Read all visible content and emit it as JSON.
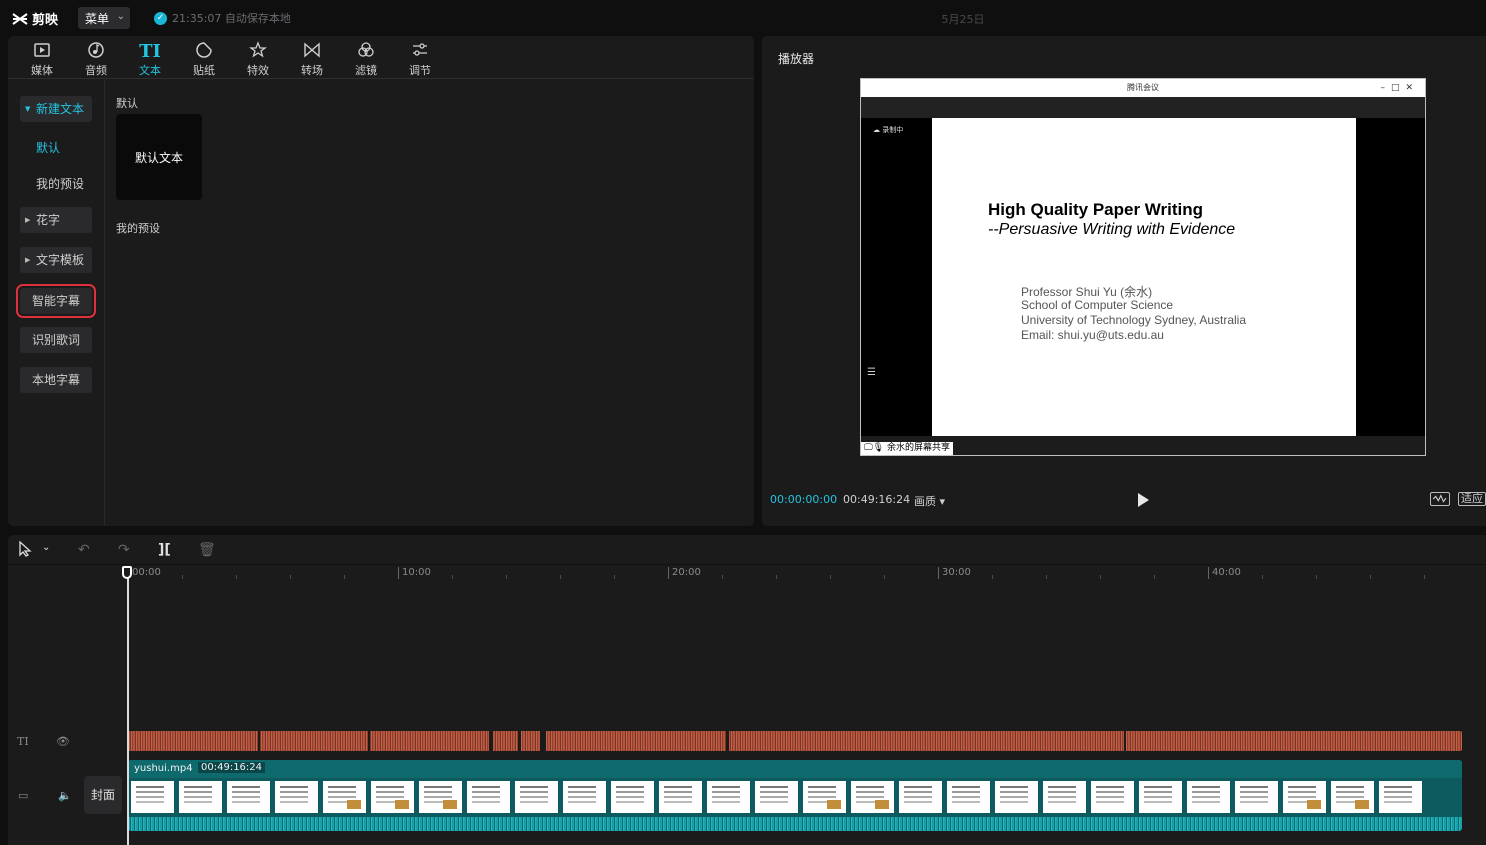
{
  "topbar": {
    "app_name": "剪映",
    "menu_label": "菜单",
    "autosave_text": "21:35:07 自动保存本地",
    "date": "5月25日"
  },
  "toolbar": {
    "tools": [
      {
        "label": "媒体",
        "icon": "media-icon"
      },
      {
        "label": "音频",
        "icon": "audio-icon"
      },
      {
        "label": "文本",
        "icon": "text-icon",
        "active": true
      },
      {
        "label": "贴纸",
        "icon": "sticker-icon"
      },
      {
        "label": "特效",
        "icon": "effects-icon"
      },
      {
        "label": "转场",
        "icon": "transition-icon"
      },
      {
        "label": "滤镜",
        "icon": "filter-icon"
      },
      {
        "label": "调节",
        "icon": "adjust-icon"
      }
    ]
  },
  "sidenav": {
    "new_text": "新建文本",
    "default": "默认",
    "my_presets": "我的预设",
    "fancy_text": "花字",
    "text_template": "文字模板",
    "smart_subtitle": "智能字幕",
    "lyrics": "识别歌词",
    "local_subtitle": "本地字幕"
  },
  "content": {
    "default_section": "默认",
    "default_card": "默认文本",
    "my_presets_section": "我的预设"
  },
  "player": {
    "title": "播放器",
    "window_title": "腾讯会议",
    "recording": "录制中",
    "share_label": "余水的屏幕共享",
    "slide": {
      "title": "High Quality Paper Writing",
      "subtitle": "--Persuasive Writing with Evidence",
      "lines": [
        "Professor Shui Yu (余水)",
        "School of Computer Science",
        "University of Technology Sydney, Australia",
        "Email: shui.yu@uts.edu.au"
      ]
    },
    "time_current": "00:00:00:00",
    "time_total": "00:49:16:24",
    "quality": "画质",
    "fit": "适应"
  },
  "timeline": {
    "ticks": [
      "00:00",
      "10:00",
      "20:00",
      "30:00",
      "40:00"
    ],
    "cover_label": "封面",
    "clip_name": "yushui.mp4",
    "clip_duration": "00:49:16:24"
  },
  "colors": {
    "accent": "#22c4df",
    "highlight_border": "#e0303a",
    "audio_track": "#b4543d",
    "video_track": "#0d5b5f"
  }
}
